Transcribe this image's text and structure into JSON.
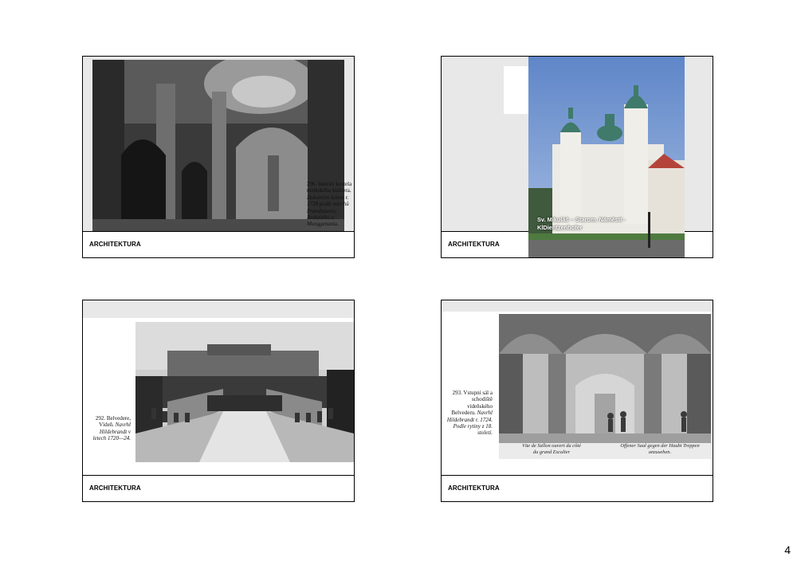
{
  "slides": [
    {
      "footer": "ARCHITEKTURA",
      "caption_plain": "296. Interiér kostela melkského kláštera.",
      "caption_italic": "Dokončen kolem r. 1738 podle návrhů Prandtauera, Beduzziho a Munggenasta."
    },
    {
      "footer": "ARCHITEKTURA",
      "overlay_caption_line1": "Sv. Mikuláš – Starom. Náměstí -",
      "overlay_caption_line2": "KlDientzenhofer"
    },
    {
      "footer": "ARCHITEKTURA",
      "caption_plain": "292. Belvedere, Vídeň.",
      "caption_italic": "Navrhl Hildebrandt v letech 1720—24."
    },
    {
      "footer": "ARCHITEKTURA",
      "caption_plain": "293. Vstupní sál a schodiště vídeňského Belvederu.",
      "caption_italic": "Navrhl Hildebrandt r. 1724. Podle rytiny z 18. století.",
      "engraving_text_left_1": "Vüe de Sallon ouvert du côté",
      "engraving_text_left_2": "du grand Escalier",
      "engraving_text_right_1": "Offener Saal gegen der Haubt Treppen",
      "engraving_text_right_2": "anzusehen."
    }
  ],
  "page_number": "4"
}
